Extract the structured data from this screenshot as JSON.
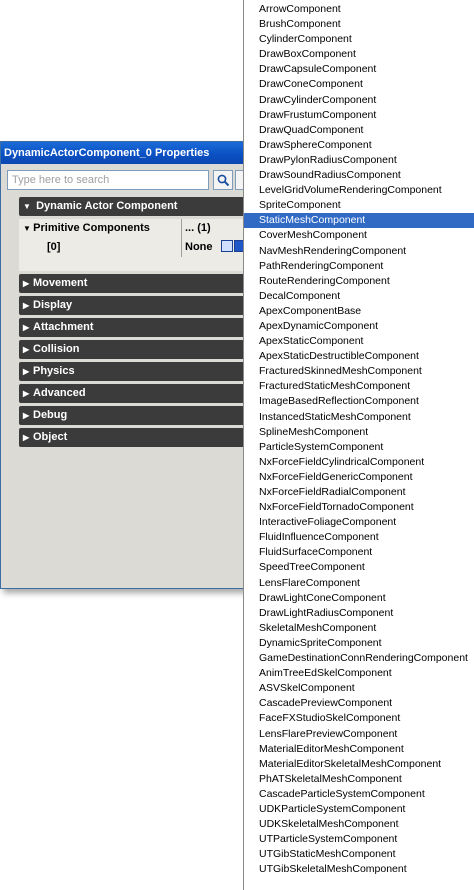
{
  "window": {
    "title": "DynamicActorComponent_0 Properties",
    "search_placeholder": "Type here to search"
  },
  "tree": {
    "root": "Dynamic Actor Component",
    "primitive_label": "Primitive Components",
    "primitive_value": "... (1)",
    "index_label": "[0]",
    "index_value": "None",
    "categories": [
      "Movement",
      "Display",
      "Attachment",
      "Collision",
      "Physics",
      "Advanced",
      "Debug",
      "Object"
    ]
  },
  "dropdown": {
    "selected": "StaticMeshComponent",
    "items": [
      "ArrowComponent",
      "BrushComponent",
      "CylinderComponent",
      "DrawBoxComponent",
      "DrawCapsuleComponent",
      "DrawConeComponent",
      "DrawCylinderComponent",
      "DrawFrustumComponent",
      "DrawQuadComponent",
      "DrawSphereComponent",
      "DrawPylonRadiusComponent",
      "DrawSoundRadiusComponent",
      "LevelGridVolumeRenderingComponent",
      "SpriteComponent",
      "StaticMeshComponent",
      "CoverMeshComponent",
      "NavMeshRenderingComponent",
      "PathRenderingComponent",
      "RouteRenderingComponent",
      "DecalComponent",
      "ApexComponentBase",
      "ApexDynamicComponent",
      "ApexStaticComponent",
      "ApexStaticDestructibleComponent",
      "FracturedSkinnedMeshComponent",
      "FracturedStaticMeshComponent",
      "ImageBasedReflectionComponent",
      "InstancedStaticMeshComponent",
      "SplineMeshComponent",
      "ParticleSystemComponent",
      "NxForceFieldCylindricalComponent",
      "NxForceFieldGenericComponent",
      "NxForceFieldRadialComponent",
      "NxForceFieldTornadoComponent",
      "InteractiveFoliageComponent",
      "FluidInfluenceComponent",
      "FluidSurfaceComponent",
      "SpeedTreeComponent",
      "LensFlareComponent",
      "DrawLightConeComponent",
      "DrawLightRadiusComponent",
      "SkeletalMeshComponent",
      "DynamicSpriteComponent",
      "GameDestinationConnRenderingComponent",
      "AnimTreeEdSkelComponent",
      "ASVSkelComponent",
      "CascadePreviewComponent",
      "FaceFXStudioSkelComponent",
      "LensFlarePreviewComponent",
      "MaterialEditorMeshComponent",
      "MaterialEditorSkeletalMeshComponent",
      "PhATSkeletalMeshComponent",
      "CascadeParticleSystemComponent",
      "UDKParticleSystemComponent",
      "UDKSkeletalMeshComponent",
      "UTParticleSystemComponent",
      "UTGibStaticMeshComponent",
      "UTGibSkeletalMeshComponent"
    ]
  }
}
